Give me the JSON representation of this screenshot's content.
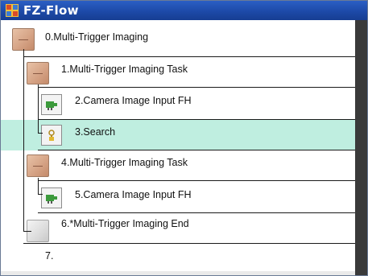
{
  "window": {
    "title": "FZ-Flow",
    "title_icon": "fz-flow-app-icon"
  },
  "flow": {
    "items": [
      {
        "label": "0.Multi-Trigger Imaging",
        "icon": "multi-trigger-task-icon"
      },
      {
        "label": "1.Multi-Trigger Imaging Task",
        "icon": "multi-trigger-task-icon"
      },
      {
        "label": "2.Camera Image Input FH",
        "icon": "camera-icon"
      },
      {
        "label": "3.Search",
        "icon": "search-tool-icon"
      },
      {
        "label": "4.Multi-Trigger Imaging Task",
        "icon": "multi-trigger-task-icon"
      },
      {
        "label": "5.Camera Image Input FH",
        "icon": "camera-icon"
      },
      {
        "label": "6.*Multi-Trigger Imaging End",
        "icon": "end-block-icon"
      },
      {
        "label": "7.",
        "icon": ""
      }
    ],
    "selected_index": 3,
    "selected_color": "#bfeee0"
  }
}
